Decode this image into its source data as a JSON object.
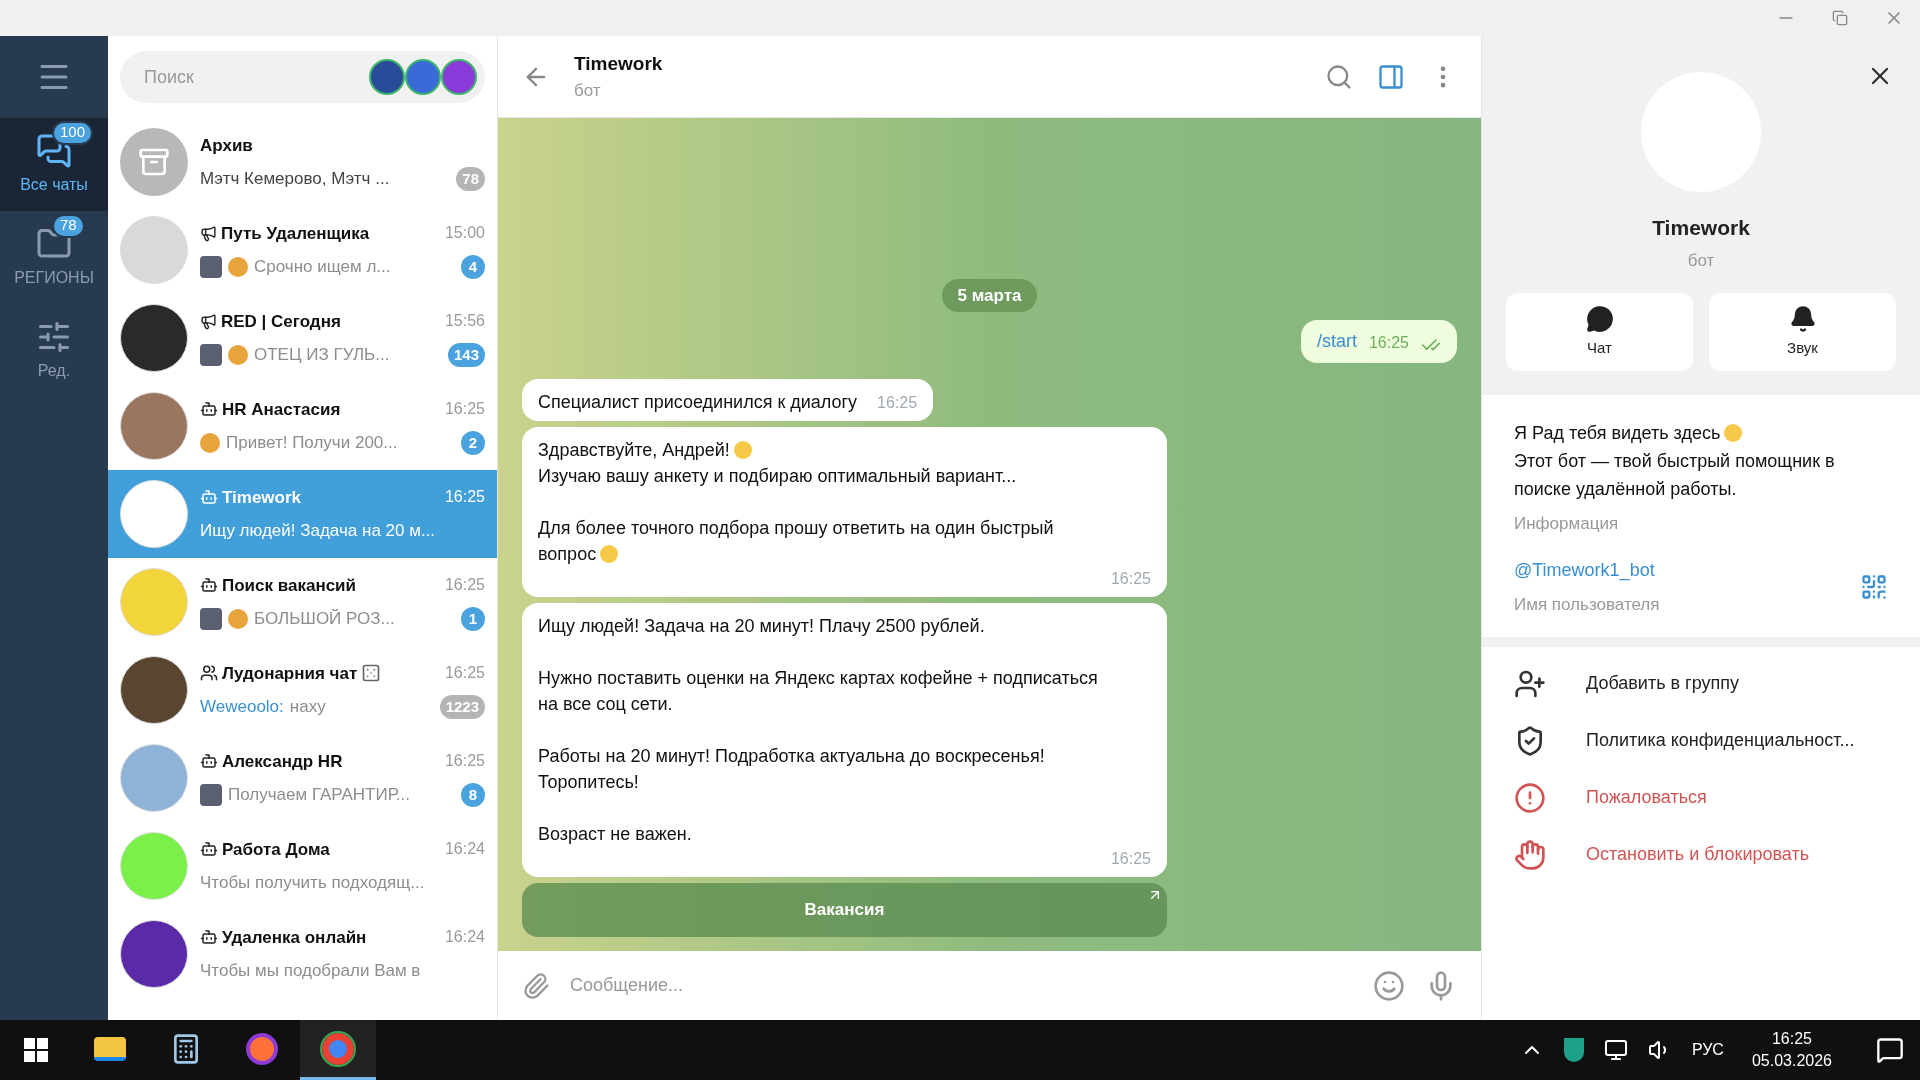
{
  "folders": [
    {
      "label": "Все чаты",
      "badge": "100",
      "selected": true,
      "kind": "chats"
    },
    {
      "label": "РЕГИОНЫ",
      "badge": "78",
      "selected": false,
      "kind": "folder"
    },
    {
      "label": "Ред.",
      "selected": false,
      "kind": "edit"
    }
  ],
  "search": {
    "placeholder": "Поиск"
  },
  "chats": [
    {
      "kind": "archive",
      "name": "Архив",
      "preview": "Мэтч Кемерово, Мэтч ...",
      "badge": "78",
      "muted": true,
      "selected": false
    },
    {
      "kind": "channel",
      "name": "Путь Удаленщика",
      "time": "15:00",
      "thumbnail": true,
      "emoji": true,
      "preview": "Срочно ищем л...",
      "badge": "4",
      "muted": false,
      "selected": false
    },
    {
      "kind": "channel",
      "name": "RED | Сегодня",
      "time": "15:56",
      "thumbnail": true,
      "emoji": true,
      "preview": "ОТЕЦ ИЗ ГУЛЬ...",
      "badge": "143",
      "muted": false,
      "selected": false
    },
    {
      "kind": "bot",
      "name": "HR Анастасия",
      "time": "16:25",
      "emoji": true,
      "preview": "Привет! Получи 200...",
      "badge": "2",
      "muted": false,
      "selected": false
    },
    {
      "kind": "bot",
      "name": "Timework",
      "time": "16:25",
      "preview": "Ищу людей! Задача на 20 м...",
      "selected": true
    },
    {
      "kind": "bot",
      "name": "Поиск вакансий",
      "time": "16:25",
      "thumbnail": true,
      "emoji": true,
      "preview": "БОЛЬШОЙ РОЗ...",
      "badge": "1",
      "muted": false,
      "selected": false
    },
    {
      "kind": "group",
      "name": "Лудонарния чат",
      "name_emoji": true,
      "time": "16:25",
      "sender": "Weweoolo:",
      "preview": "наху",
      "badge": "1223",
      "muted": true,
      "selected": false
    },
    {
      "kind": "bot",
      "name": "Александр HR",
      "time": "16:25",
      "thumbnail": true,
      "preview": "Получаем ГАРАНТИР...",
      "badge": "8",
      "muted": false,
      "selected": false
    },
    {
      "kind": "bot",
      "name": "Работа Дома",
      "time": "16:24",
      "preview": "Чтобы получить подходящ...",
      "selected": false
    },
    {
      "kind": "bot",
      "name": "Удаленка онлайн",
      "time": "16:24",
      "preview": "Чтобы мы подобрали Вам в",
      "selected": false
    }
  ],
  "chat_header": {
    "title": "Timework",
    "subtitle": "бот"
  },
  "messages": [
    {
      "kind": "date",
      "text": "5 марта"
    },
    {
      "kind": "outgoing",
      "blocks": [
        {
          "lines": [
            {
              "text": "/start"
            }
          ]
        }
      ],
      "time": "16:25",
      "read": true
    },
    {
      "kind": "incoming",
      "blocks": [
        {
          "lines": [
            {
              "text": "Специалист присоединился к диалогу"
            }
          ]
        }
      ],
      "time": "16:25"
    },
    {
      "kind": "incoming",
      "blocks": [
        {
          "lines": [
            {
              "text": "Здравствуйте, Андрей!",
              "emoji": true
            },
            {
              "text": "Изучаю вашу анкету и подбираю оптимальный вариант..."
            }
          ]
        },
        {
          "lines": [
            {
              "text": "Для более точного подбора прошу ответить на один быстрый вопрос",
              "emoji": true
            }
          ]
        }
      ],
      "time": "16:25"
    },
    {
      "kind": "incoming",
      "blocks": [
        {
          "lines": [
            {
              "text": "Ищу людей! Задача на 20 минут! Плачу 2500 рублей."
            }
          ]
        },
        {
          "lines": [
            {
              "text": "Нужно поставить оценки на Яндекс картах кофейне + подписаться на все соц сети."
            }
          ]
        },
        {
          "lines": [
            {
              "text": "Работы на 20 минут! Подработка актуальна до воскресенья! Торопитесь!"
            }
          ]
        },
        {
          "lines": [
            {
              "text": "Возраст не важен."
            }
          ]
        }
      ],
      "time": "16:25"
    },
    {
      "kind": "button",
      "text": "Вакансия"
    }
  ],
  "composer": {
    "placeholder": "Сообщение..."
  },
  "profile": {
    "name": "Timework",
    "subtitle": "бот",
    "buttons": [
      {
        "kind": "chat",
        "label": "Чат"
      },
      {
        "kind": "sound",
        "label": "Звук"
      }
    ],
    "bio": [
      {
        "lines": [
          {
            "text": "Я Рад тебя видеть здесь",
            "emoji": true
          },
          {
            "text": "Этот бот — твой быстрый помощник в поиске удалённой работы."
          }
        ]
      }
    ],
    "bio_label": "Информация",
    "username": "@Timework1_bot",
    "username_label": "Имя пользователя",
    "actions": [
      {
        "kind": "add",
        "label": "Добавить в группу",
        "danger": false
      },
      {
        "kind": "privacy",
        "label": "Политика конфиденциальност...",
        "danger": false
      },
      {
        "kind": "report",
        "label": "Пожаловаться",
        "danger": true
      },
      {
        "kind": "block",
        "label": "Остановить и блокировать",
        "danger": true
      }
    ]
  },
  "taskbar": {
    "apps": [
      {
        "kind": "explorer",
        "selected": false
      },
      {
        "kind": "calculator",
        "selected": false
      },
      {
        "kind": "firefox",
        "selected": false
      },
      {
        "kind": "chrome",
        "selected": true
      }
    ],
    "language": "РУС",
    "time": "16:25",
    "date": "05.03.2026"
  }
}
